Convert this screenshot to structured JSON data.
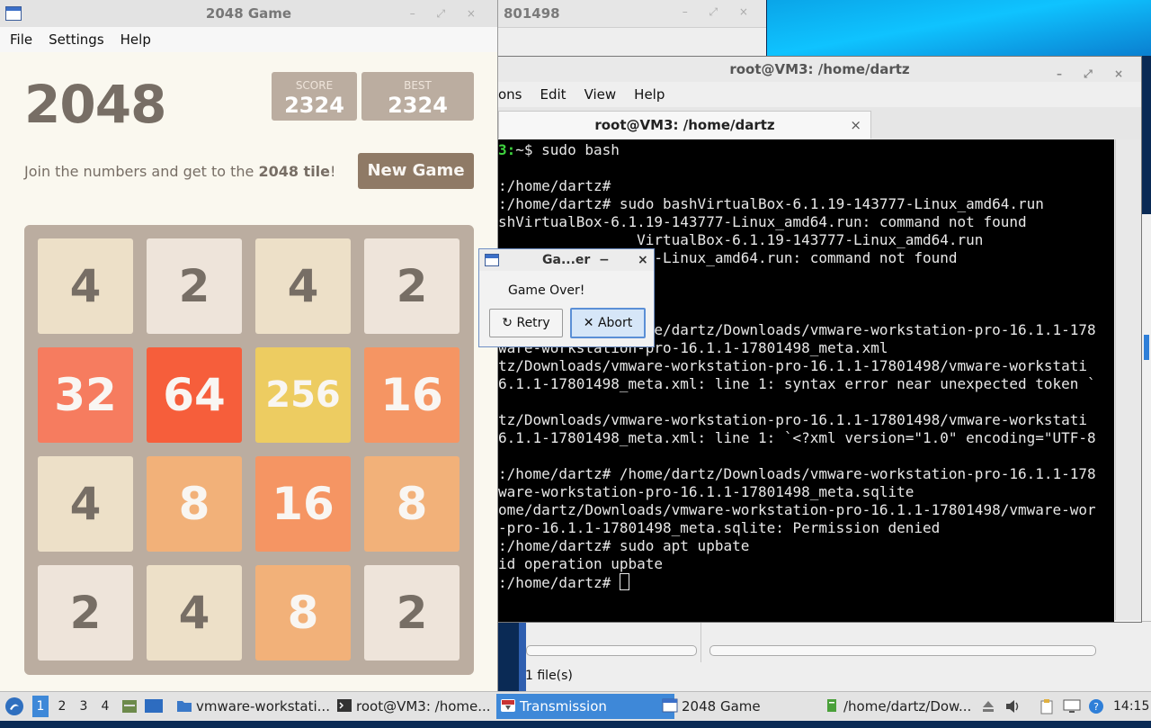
{
  "game": {
    "window_title": "2048 Game",
    "menu": [
      "File",
      "Settings",
      "Help"
    ],
    "title": "2048",
    "score_label": "SCORE",
    "score": "2324",
    "best_label": "BEST",
    "best": "2324",
    "tagline_prefix": "Join the numbers and get to the ",
    "tagline_bold": "2048 tile",
    "tagline_suffix": "!",
    "new_game": "New Game",
    "grid": [
      [
        4,
        2,
        4,
        2
      ],
      [
        32,
        64,
        256,
        16
      ],
      [
        4,
        8,
        16,
        8
      ],
      [
        2,
        4,
        8,
        2
      ]
    ],
    "tile_colors": {
      "2": {
        "bg": "#eee4da",
        "fg": "#776e65"
      },
      "4": {
        "bg": "#ede0c8",
        "fg": "#776e65"
      },
      "8": {
        "bg": "#f2b179",
        "fg": "#f9f6f2"
      },
      "16": {
        "bg": "#f59563",
        "fg": "#f9f6f2"
      },
      "32": {
        "bg": "#f67c5f",
        "fg": "#f9f6f2"
      },
      "64": {
        "bg": "#f65e3b",
        "fg": "#f9f6f2"
      },
      "256": {
        "bg": "#edcc61",
        "fg": "#f9f6f2"
      }
    }
  },
  "dialog": {
    "title": "Ga...er",
    "minimize": "−",
    "close": "×",
    "message": "Game Over!",
    "retry": "Retry",
    "abort": "Abort",
    "retry_icon": "↻",
    "abort_icon": "✕"
  },
  "bg_window": {
    "title_fragment": "801498"
  },
  "terminal": {
    "window_title": "root@VM3: /home/dartz",
    "menu": [
      "ons",
      "Edit",
      "View",
      "Help"
    ],
    "tab_title": "root@VM3: /home/dartz",
    "tab_close": "×",
    "lines": [
      {
        "green": "3:",
        "text": "~$ sudo bash"
      },
      {
        "green": "",
        "text": ""
      },
      {
        "green": "",
        "text": ":/home/dartz#"
      },
      {
        "green": "",
        "text": ":/home/dartz# sudo bashVirtualBox-6.1.19-143777-Linux_amd64.run"
      },
      {
        "green": "",
        "text": "shVirtualBox-6.1.19-143777-Linux_amd64.run: command not found"
      },
      {
        "green": "",
        "text": "                VirtualBox-6.1.19-143777-Linux_amd64.run"
      },
      {
        "green": "",
        "text": "                77-Linux_amd64.run: command not found"
      },
      {
        "green": "",
        "text": ""
      },
      {
        "green": "",
        "text": ""
      },
      {
        "green": "",
        "text": ""
      },
      {
        "green": "",
        "text": ":/home/dartz# /home/dartz/Downloads/vmware-workstation-pro-16.1.1-178"
      },
      {
        "green": "",
        "text": "ware-workstation-pro-16.1.1-17801498_meta.xml"
      },
      {
        "green": "",
        "text": "tz/Downloads/vmware-workstation-pro-16.1.1-17801498/vmware-workstati"
      },
      {
        "green": "",
        "text": "6.1.1-17801498_meta.xml: line 1: syntax error near unexpected token `"
      },
      {
        "green": "",
        "text": ""
      },
      {
        "green": "",
        "text": "tz/Downloads/vmware-workstation-pro-16.1.1-17801498/vmware-workstati"
      },
      {
        "green": "",
        "text": "6.1.1-17801498_meta.xml: line 1: `<?xml version=\"1.0\" encoding=\"UTF-8"
      },
      {
        "green": "",
        "text": ""
      },
      {
        "green": "",
        "text": ":/home/dartz# /home/dartz/Downloads/vmware-workstation-pro-16.1.1-178"
      },
      {
        "green": "",
        "text": "ware-workstation-pro-16.1.1-17801498_meta.sqlite"
      },
      {
        "green": "",
        "text": "ome/dartz/Downloads/vmware-workstation-pro-16.1.1-17801498/vmware-wor"
      },
      {
        "green": "",
        "text": "-pro-16.1.1-17801498_meta.sqlite: Permission denied"
      },
      {
        "green": "",
        "text": ":/home/dartz# sudo apt upbate"
      },
      {
        "green": "",
        "text": "id operation upbate"
      },
      {
        "green": "",
        "text": ":/home/dartz# "
      }
    ]
  },
  "file_manager": {
    "status": "1 file(s)"
  },
  "taskbar": {
    "workspaces": [
      "1",
      "2",
      "3",
      "4"
    ],
    "tasks": [
      {
        "label": "vmware-workstati...",
        "icon": "folder-icon"
      },
      {
        "label": "root@VM3: /home...",
        "icon": "terminal-icon"
      },
      {
        "label": "Transmission",
        "icon": "transmission-icon"
      },
      {
        "label": "2048 Game",
        "icon": "window-icon"
      },
      {
        "label": "/home/dartz/Dow...",
        "icon": "file-icon"
      }
    ],
    "clock": "14:15",
    "accent": "#3e88d8"
  }
}
